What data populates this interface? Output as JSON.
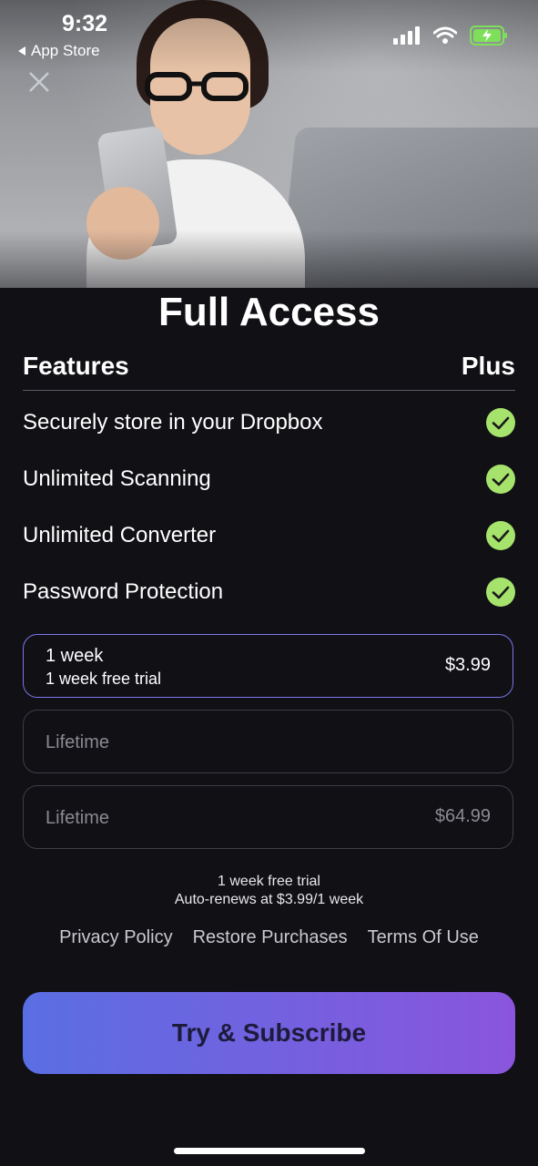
{
  "status_bar": {
    "time": "9:32",
    "back_label": "App Store",
    "icons": [
      "cellular-signal-icon",
      "wifi-icon",
      "battery-charging-icon"
    ],
    "battery_color": "#7ee05a"
  },
  "hero": {
    "image": "woman-with-glasses-holding-phone-photo"
  },
  "title": "Full Access",
  "features": {
    "header_left": "Features",
    "header_right": "Plus",
    "items": [
      "Securely store in your Dropbox",
      "Unlimited Scanning",
      "Unlimited Converter",
      "Password Protection"
    ],
    "check_color": "#a6e36c"
  },
  "plans": [
    {
      "name": "1 week",
      "subtitle": "1 week free trial",
      "price": "$3.99",
      "selected": true
    },
    {
      "name": "Lifetime",
      "subtitle": "",
      "price": "",
      "selected": false
    },
    {
      "name": "Lifetime",
      "subtitle": "",
      "price": "$64.99",
      "selected": false
    }
  ],
  "trial_note": {
    "line1": "1 week free trial",
    "line2": "Auto-renews at $3.99/1 week"
  },
  "links": {
    "privacy": "Privacy Policy",
    "restore": "Restore Purchases",
    "terms": "Terms Of Use"
  },
  "cta": {
    "label": "Try & Subscribe",
    "gradient_start": "#5a6ee3",
    "gradient_end": "#8a55dc"
  },
  "accent_color": "#7c76ee"
}
